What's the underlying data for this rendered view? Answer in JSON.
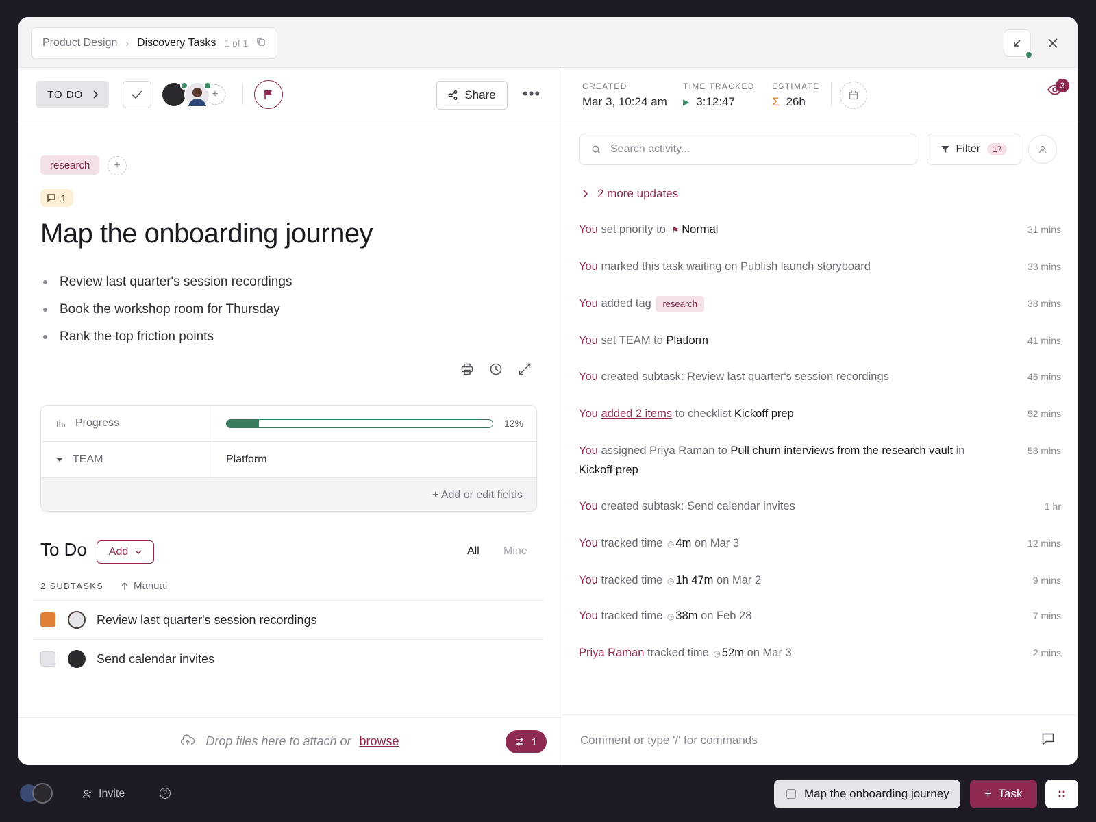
{
  "breadcrumb": {
    "space": "Product Design",
    "list": "Discovery Tasks",
    "count": "1 of 1"
  },
  "task": {
    "status": "TO DO",
    "tag": "research",
    "comment_count": "1",
    "title": "Map the onboarding journey",
    "bullets": [
      "Review last quarter's session recordings",
      "Book the workshop room for Thursday",
      "Rank the top friction points"
    ],
    "share_label": "Share"
  },
  "fields": {
    "progress_label": "Progress",
    "progress_value": 12,
    "progress_text": "12%",
    "team_label": "TEAM",
    "team_value": "Platform",
    "add_fields": "+ Add or edit fields"
  },
  "todo": {
    "heading": "To Do",
    "add_label": "Add",
    "filter_all": "All",
    "filter_mine": "Mine",
    "subtasks_label": "2 SUBTASKS",
    "sort_label": "Manual",
    "subtasks": [
      {
        "name": "Review last quarter's session recordings",
        "status_color": "#e07f34"
      },
      {
        "name": "Send calendar invites",
        "status_color": "#e6e4e9"
      }
    ]
  },
  "dropzone": {
    "text": "Drop files here to attach or",
    "link": "browse",
    "relations_count": "1"
  },
  "meta": {
    "created_label": "CREATED",
    "created_value": "Mar 3, 10:24 am",
    "tracked_label": "TIME TRACKED",
    "tracked_value": "3:12:47",
    "estimate_label": "ESTIMATE",
    "estimate_value": "26h",
    "watchers_count": "3"
  },
  "activity": {
    "search_placeholder": "Search activity...",
    "filter_label": "Filter",
    "filter_count": "17",
    "more_updates": "2 more updates",
    "items": [
      {
        "who": "You",
        "a": "set priority to",
        "b": "Normal",
        "time": "31 mins"
      },
      {
        "who": "You",
        "a": "marked this task waiting on Publish launch storyboard",
        "time": "33 mins"
      },
      {
        "who": "You",
        "a": "added tag",
        "tag": "research",
        "time": "38 mins"
      },
      {
        "who": "You",
        "a": "set TEAM to",
        "b": "Platform",
        "time": "41 mins"
      },
      {
        "who": "You",
        "a": "created subtask: Review last quarter's session recordings",
        "time": "46 mins"
      },
      {
        "who": "You",
        "link": "added 2 items",
        "a": "to checklist",
        "b": "Kickoff prep",
        "time": "52 mins"
      },
      {
        "who": "You",
        "a": "assigned Priya Raman to",
        "b": "Pull churn interviews from the research vault",
        "c": "in",
        "d": "Kickoff prep",
        "time": "58 mins"
      },
      {
        "who": "You",
        "a": "created subtask: Send calendar invites",
        "time": "1 hr"
      },
      {
        "who": "You",
        "a": "tracked time",
        "b": "4m",
        "c": "on Mar 3",
        "time": "12 mins"
      },
      {
        "who": "You",
        "a": "tracked time",
        "b": "1h 47m",
        "c": "on Mar 2",
        "time": "9 mins"
      },
      {
        "who": "You",
        "a": "tracked time",
        "b": "38m",
        "c": "on Feb 28",
        "time": "7 mins"
      },
      {
        "who": "Priya Raman",
        "a": "tracked time",
        "b": "52m",
        "c": "on Mar 3",
        "time": "2 mins"
      }
    ],
    "comment_placeholder": "Comment or type '/' for commands"
  },
  "footer": {
    "invite_label": "Invite",
    "tray_task": "Map the onboarding journey",
    "new_task_label": "Task"
  },
  "colors": {
    "accent": "#8e2a52",
    "success": "#3a8a62",
    "warning": "#e07f34"
  }
}
